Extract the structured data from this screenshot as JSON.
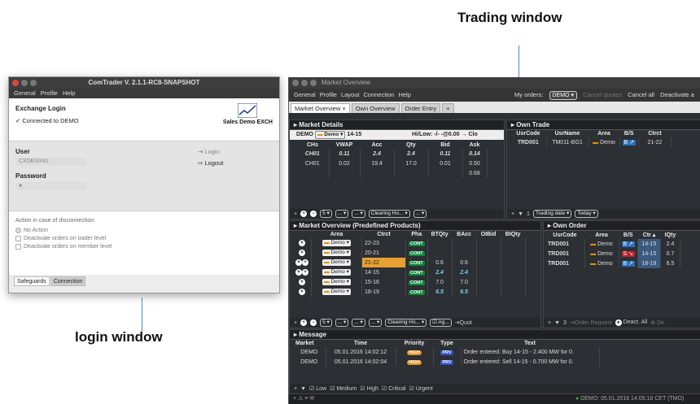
{
  "callouts": {
    "trading": "Trading window",
    "login": "login window"
  },
  "login": {
    "title": "ComTrader V. 2.1.1-RC8-SNAPSHOT",
    "menu": [
      "General",
      "Profile",
      "Help"
    ],
    "exchange_login": "Exchange Login",
    "connected": "Connected to DEMO",
    "brand": "Sales Demo EXCH",
    "user_label": "User",
    "user_value": "CXDBSX41",
    "password_label": "Password",
    "password_value": "●",
    "login_btn": "Login",
    "logout_btn": "Logout",
    "disconnect_title": "Action in case of disconnection:",
    "options": [
      "No Action",
      "Deactivate orders on trader level",
      "Deactivate orders on member level"
    ],
    "tabs": [
      "Safeguards",
      "Connection"
    ]
  },
  "trade": {
    "title": "Market Overview",
    "menu": [
      "General",
      "Profile",
      "Layout",
      "Connection",
      "Help"
    ],
    "my_orders_label": "My orders:",
    "my_orders_value": "DEMO ▾",
    "cancel_quotes": "Cancel quotes",
    "cancel_all": "Cancel all",
    "deactivate": "Deactivate a",
    "tabs": [
      "Market Overview ×",
      "Own Overview",
      "Order Entry",
      "+"
    ],
    "market_details": {
      "title": "Market Details",
      "area": "Demo ▾",
      "contract": "14-15",
      "hilow": "Hi/Low:  -/-  -@0.00 → Clo",
      "cols": [
        "CHs",
        "VWAP",
        "Acc",
        "Qty",
        "Bid",
        "Ask"
      ],
      "rows": [
        [
          "CH01",
          "0.11",
          "2.4",
          "2.4",
          "0.11",
          "0.14"
        ],
        [
          "CH01",
          "0.02",
          "19.4",
          "17.0",
          "0.01",
          "0.50"
        ],
        [
          "",
          "",
          "",
          "",
          "",
          "0.68"
        ]
      ],
      "toolbar": [
        "5 ▾",
        "... ▾",
        "... ▾",
        "Clearing Ho... ▾",
        "... ▾"
      ]
    },
    "own_trade": {
      "title": "Own Trade",
      "cols": [
        "UsrCode",
        "UsrName",
        "Area",
        "B/S",
        "Ctrct"
      ],
      "rows": [
        [
          "TRD001",
          "TM011-BG1",
          "Demo",
          "B ↗",
          "21-22"
        ]
      ],
      "toolbar": [
        "1",
        "Trading date ▾",
        "Today ▾"
      ]
    },
    "mkt_overview": {
      "title": "Market Overview (Predefined Products)",
      "cols": [
        "Area",
        "Ctrct",
        "Pha",
        "BTQty",
        "BAcc",
        "OIBid",
        "BIQty"
      ],
      "rows": [
        [
          "Demo ▾",
          "22-23",
          "CONT",
          "",
          "",
          "",
          ""
        ],
        [
          "Demo ▾",
          "20-21",
          "CONT",
          "",
          "",
          "",
          ""
        ],
        [
          "Demo ▾",
          "21-22",
          "CONT",
          "0.6",
          "0.6",
          "",
          ""
        ],
        [
          "Demo ▾",
          "14-15",
          "CONT",
          "2.4",
          "2.4",
          "",
          ""
        ],
        [
          "Demo ▾",
          "15-16",
          "CONT",
          "7.0",
          "7.0",
          "",
          ""
        ],
        [
          "Demo ▾",
          "18-19",
          "CONT",
          "6.5",
          "6.5",
          "",
          ""
        ]
      ],
      "toolbar": [
        "5 ▾",
        "... ▾",
        "... ▾",
        "... ▾",
        "Clearing Ho... ▾",
        "Ag...",
        "Quot"
      ]
    },
    "own_order": {
      "title": "Own Order",
      "cols": [
        "UsrCode",
        "Area",
        "B/S",
        "Ctr ▴",
        "IQty"
      ],
      "rows": [
        [
          "TRD001",
          "Demo",
          "B ↗",
          "14-15",
          "2.4"
        ],
        [
          "TRD001",
          "Demo",
          "S ↘",
          "14-15",
          "0.7"
        ],
        [
          "TRD001",
          "Demo",
          "B ↗",
          "18-19",
          "6.5"
        ]
      ],
      "toolbar": [
        "3",
        "Order Request",
        "Deact. All",
        "De"
      ]
    },
    "message": {
      "title": "Message",
      "cols": [
        "Market",
        "Time",
        "Priority",
        "Type",
        "Text"
      ],
      "rows": [
        [
          "DEMO",
          "05.01.2016 14:02:12",
          "HIGH",
          "PRV",
          "Order entered: Buy 14-15 - 2.400 MW for 0."
        ],
        [
          "DEMO",
          "05.01.2016 14:02:04",
          "HIGH",
          "PRV",
          "Order entered: Sell 14-15 - 0.700 MW for 0."
        ]
      ],
      "filters": [
        "Low",
        "Medium",
        "High",
        "Critical",
        "Urgent"
      ]
    },
    "status": "DEMO: 05.01.2016 14:05:18 CET (TMO)"
  }
}
